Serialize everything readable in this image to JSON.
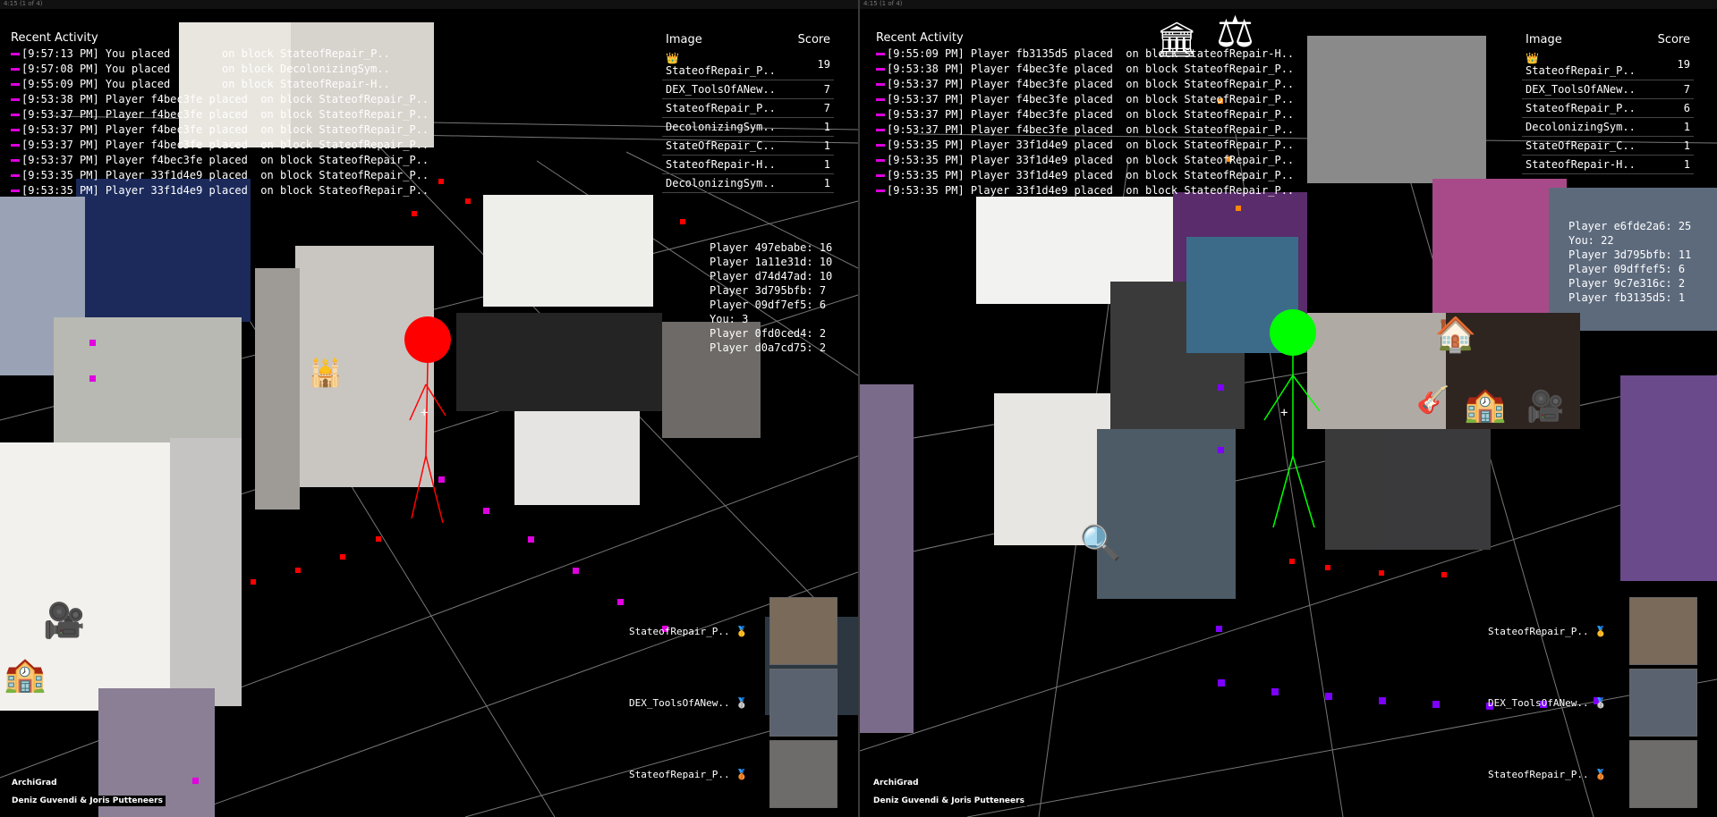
{
  "left": {
    "window_title": "4:15 (1 of 4)",
    "recent_activity_title": "Recent Activity",
    "activity": [
      "[9:57:13 PM] You placed        on block StateofRepair_P..",
      "[9:57:08 PM] You placed        on block DecolonizingSym..",
      "[9:55:09 PM] You placed        on block StateofRepair-H..",
      "[9:53:38 PM] Player f4bec3fe placed  on block StateofRepair_P..",
      "[9:53:37 PM] Player f4bec3fe placed  on block StateofRepair_P..",
      "[9:53:37 PM] Player f4bec3fe placed  on block StateofRepair_P..",
      "[9:53:37 PM] Player f4bec3fe placed  on block StateofRepair_P..",
      "[9:53:37 PM] Player f4bec3fe placed  on block StateofRepair_P..",
      "[9:53:35 PM] Player 33f1d4e9 placed  on block StateofRepair_P..",
      "[9:53:35 PM] Player 33f1d4e9 placed  on block StateofRepair_P.."
    ],
    "score_header_image": "Image",
    "score_header_score": "Score",
    "scores": [
      {
        "name": "👑 StateofRepair_P..",
        "score": "19"
      },
      {
        "name": "DEX_ToolsOfANew..",
        "score": "7"
      },
      {
        "name": "StateofRepair_P..",
        "score": "7"
      },
      {
        "name": "DecolonizingSym..",
        "score": "1"
      },
      {
        "name": "StateOfRepair_C..",
        "score": "1"
      },
      {
        "name": "StateofRepair-H..",
        "score": "1"
      },
      {
        "name": "DecolonizingSym..",
        "score": "1"
      }
    ],
    "players": [
      "Player 497ebabe: 16",
      "Player 1a11e31d: 10",
      "Player d74d47ad: 10",
      "Player 3d795bfb: 7",
      "Player 09df7ef5: 6",
      "You: 3",
      "Player 0fd0ced4: 2",
      "Player d0a7cd75: 2"
    ],
    "cube_labels": [
      "StateofRepair_P.. 🥇",
      "DEX_ToolsOfANew.. 🥈",
      "StateofRepair_P.. 🥉"
    ],
    "credit_app": "ArchiGrad",
    "credit_authors": "Deniz Guvendi & Joris Putteneers",
    "avatar_color": "#ff0000"
  },
  "right": {
    "window_title": "4:15 (1 of 4)",
    "recent_activity_title": "Recent Activity",
    "activity": [
      "[9:55:09 PM] Player fb3135d5 placed  on block StateofRepair-H..",
      "[9:53:38 PM] Player f4bec3fe placed  on block StateofRepair_P..",
      "[9:53:37 PM] Player f4bec3fe placed  on block StateofRepair_P..",
      "[9:53:37 PM] Player f4bec3fe placed  on block StateofRepair_P..",
      "[9:53:37 PM] Player f4bec3fe placed  on block StateofRepair_P..",
      "[9:53:37 PM] Player f4bec3fe placed  on block StateofRepair_P..",
      "[9:53:35 PM] Player 33f1d4e9 placed  on block StateofRepair_P..",
      "[9:53:35 PM] Player 33f1d4e9 placed  on block StateofRepair_P..",
      "[9:53:35 PM] Player 33f1d4e9 placed  on block StateofRepair_P..",
      "[9:53:35 PM] Player 33f1d4e9 placed  on block StateofRepair_P.."
    ],
    "score_header_image": "Image",
    "score_header_score": "Score",
    "scores": [
      {
        "name": "👑 StateofRepair_P..",
        "score": "19"
      },
      {
        "name": "DEX_ToolsOfANew..",
        "score": "7"
      },
      {
        "name": "StateofRepair_P..",
        "score": "6"
      },
      {
        "name": "DecolonizingSym..",
        "score": "1"
      },
      {
        "name": "StateOfRepair_C..",
        "score": "1"
      },
      {
        "name": "StateofRepair-H..",
        "score": "1"
      }
    ],
    "players": [
      "Player e6fde2a6: 25",
      "You: 22",
      "Player 3d795bfb: 11",
      "Player 09dffef5: 6",
      "Player 9c7e316c: 2",
      "Player fb3135d5: 1"
    ],
    "cube_labels": [
      "StateofRepair_P.. 🥇",
      "DEX_ToolsOfANew.. 🥈",
      "StateofRepair_P.. 🥉"
    ],
    "credit_app": "ArchiGrad",
    "credit_authors": "Deniz Guvendi & Joris Putteneers",
    "avatar_color": "#00ff00"
  }
}
